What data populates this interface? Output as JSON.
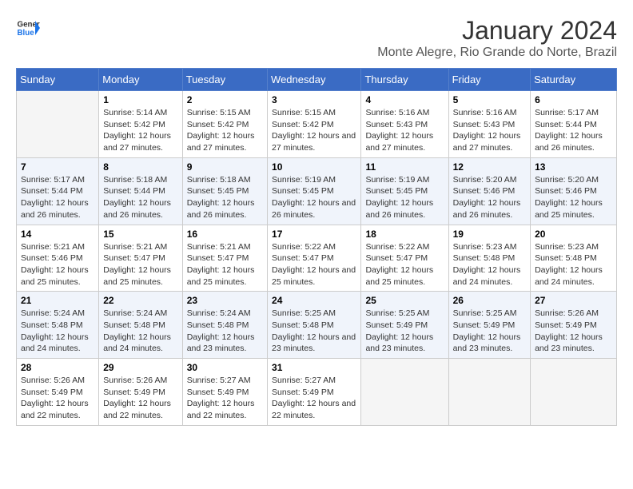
{
  "header": {
    "logo_line1": "General",
    "logo_line2": "Blue",
    "month": "January 2024",
    "location": "Monte Alegre, Rio Grande do Norte, Brazil"
  },
  "weekdays": [
    "Sunday",
    "Monday",
    "Tuesday",
    "Wednesday",
    "Thursday",
    "Friday",
    "Saturday"
  ],
  "weeks": [
    [
      {
        "day": "",
        "sunrise": "",
        "sunset": "",
        "daylight": ""
      },
      {
        "day": "1",
        "sunrise": "Sunrise: 5:14 AM",
        "sunset": "Sunset: 5:42 PM",
        "daylight": "Daylight: 12 hours and 27 minutes."
      },
      {
        "day": "2",
        "sunrise": "Sunrise: 5:15 AM",
        "sunset": "Sunset: 5:42 PM",
        "daylight": "Daylight: 12 hours and 27 minutes."
      },
      {
        "day": "3",
        "sunrise": "Sunrise: 5:15 AM",
        "sunset": "Sunset: 5:42 PM",
        "daylight": "Daylight: 12 hours and 27 minutes."
      },
      {
        "day": "4",
        "sunrise": "Sunrise: 5:16 AM",
        "sunset": "Sunset: 5:43 PM",
        "daylight": "Daylight: 12 hours and 27 minutes."
      },
      {
        "day": "5",
        "sunrise": "Sunrise: 5:16 AM",
        "sunset": "Sunset: 5:43 PM",
        "daylight": "Daylight: 12 hours and 27 minutes."
      },
      {
        "day": "6",
        "sunrise": "Sunrise: 5:17 AM",
        "sunset": "Sunset: 5:44 PM",
        "daylight": "Daylight: 12 hours and 26 minutes."
      }
    ],
    [
      {
        "day": "7",
        "sunrise": "Sunrise: 5:17 AM",
        "sunset": "Sunset: 5:44 PM",
        "daylight": "Daylight: 12 hours and 26 minutes."
      },
      {
        "day": "8",
        "sunrise": "Sunrise: 5:18 AM",
        "sunset": "Sunset: 5:44 PM",
        "daylight": "Daylight: 12 hours and 26 minutes."
      },
      {
        "day": "9",
        "sunrise": "Sunrise: 5:18 AM",
        "sunset": "Sunset: 5:45 PM",
        "daylight": "Daylight: 12 hours and 26 minutes."
      },
      {
        "day": "10",
        "sunrise": "Sunrise: 5:19 AM",
        "sunset": "Sunset: 5:45 PM",
        "daylight": "Daylight: 12 hours and 26 minutes."
      },
      {
        "day": "11",
        "sunrise": "Sunrise: 5:19 AM",
        "sunset": "Sunset: 5:45 PM",
        "daylight": "Daylight: 12 hours and 26 minutes."
      },
      {
        "day": "12",
        "sunrise": "Sunrise: 5:20 AM",
        "sunset": "Sunset: 5:46 PM",
        "daylight": "Daylight: 12 hours and 26 minutes."
      },
      {
        "day": "13",
        "sunrise": "Sunrise: 5:20 AM",
        "sunset": "Sunset: 5:46 PM",
        "daylight": "Daylight: 12 hours and 25 minutes."
      }
    ],
    [
      {
        "day": "14",
        "sunrise": "Sunrise: 5:21 AM",
        "sunset": "Sunset: 5:46 PM",
        "daylight": "Daylight: 12 hours and 25 minutes."
      },
      {
        "day": "15",
        "sunrise": "Sunrise: 5:21 AM",
        "sunset": "Sunset: 5:47 PM",
        "daylight": "Daylight: 12 hours and 25 minutes."
      },
      {
        "day": "16",
        "sunrise": "Sunrise: 5:21 AM",
        "sunset": "Sunset: 5:47 PM",
        "daylight": "Daylight: 12 hours and 25 minutes."
      },
      {
        "day": "17",
        "sunrise": "Sunrise: 5:22 AM",
        "sunset": "Sunset: 5:47 PM",
        "daylight": "Daylight: 12 hours and 25 minutes."
      },
      {
        "day": "18",
        "sunrise": "Sunrise: 5:22 AM",
        "sunset": "Sunset: 5:47 PM",
        "daylight": "Daylight: 12 hours and 25 minutes."
      },
      {
        "day": "19",
        "sunrise": "Sunrise: 5:23 AM",
        "sunset": "Sunset: 5:48 PM",
        "daylight": "Daylight: 12 hours and 24 minutes."
      },
      {
        "day": "20",
        "sunrise": "Sunrise: 5:23 AM",
        "sunset": "Sunset: 5:48 PM",
        "daylight": "Daylight: 12 hours and 24 minutes."
      }
    ],
    [
      {
        "day": "21",
        "sunrise": "Sunrise: 5:24 AM",
        "sunset": "Sunset: 5:48 PM",
        "daylight": "Daylight: 12 hours and 24 minutes."
      },
      {
        "day": "22",
        "sunrise": "Sunrise: 5:24 AM",
        "sunset": "Sunset: 5:48 PM",
        "daylight": "Daylight: 12 hours and 24 minutes."
      },
      {
        "day": "23",
        "sunrise": "Sunrise: 5:24 AM",
        "sunset": "Sunset: 5:48 PM",
        "daylight": "Daylight: 12 hours and 23 minutes."
      },
      {
        "day": "24",
        "sunrise": "Sunrise: 5:25 AM",
        "sunset": "Sunset: 5:48 PM",
        "daylight": "Daylight: 12 hours and 23 minutes."
      },
      {
        "day": "25",
        "sunrise": "Sunrise: 5:25 AM",
        "sunset": "Sunset: 5:49 PM",
        "daylight": "Daylight: 12 hours and 23 minutes."
      },
      {
        "day": "26",
        "sunrise": "Sunrise: 5:25 AM",
        "sunset": "Sunset: 5:49 PM",
        "daylight": "Daylight: 12 hours and 23 minutes."
      },
      {
        "day": "27",
        "sunrise": "Sunrise: 5:26 AM",
        "sunset": "Sunset: 5:49 PM",
        "daylight": "Daylight: 12 hours and 23 minutes."
      }
    ],
    [
      {
        "day": "28",
        "sunrise": "Sunrise: 5:26 AM",
        "sunset": "Sunset: 5:49 PM",
        "daylight": "Daylight: 12 hours and 22 minutes."
      },
      {
        "day": "29",
        "sunrise": "Sunrise: 5:26 AM",
        "sunset": "Sunset: 5:49 PM",
        "daylight": "Daylight: 12 hours and 22 minutes."
      },
      {
        "day": "30",
        "sunrise": "Sunrise: 5:27 AM",
        "sunset": "Sunset: 5:49 PM",
        "daylight": "Daylight: 12 hours and 22 minutes."
      },
      {
        "day": "31",
        "sunrise": "Sunrise: 5:27 AM",
        "sunset": "Sunset: 5:49 PM",
        "daylight": "Daylight: 12 hours and 22 minutes."
      },
      {
        "day": "",
        "sunrise": "",
        "sunset": "",
        "daylight": ""
      },
      {
        "day": "",
        "sunrise": "",
        "sunset": "",
        "daylight": ""
      },
      {
        "day": "",
        "sunrise": "",
        "sunset": "",
        "daylight": ""
      }
    ]
  ]
}
